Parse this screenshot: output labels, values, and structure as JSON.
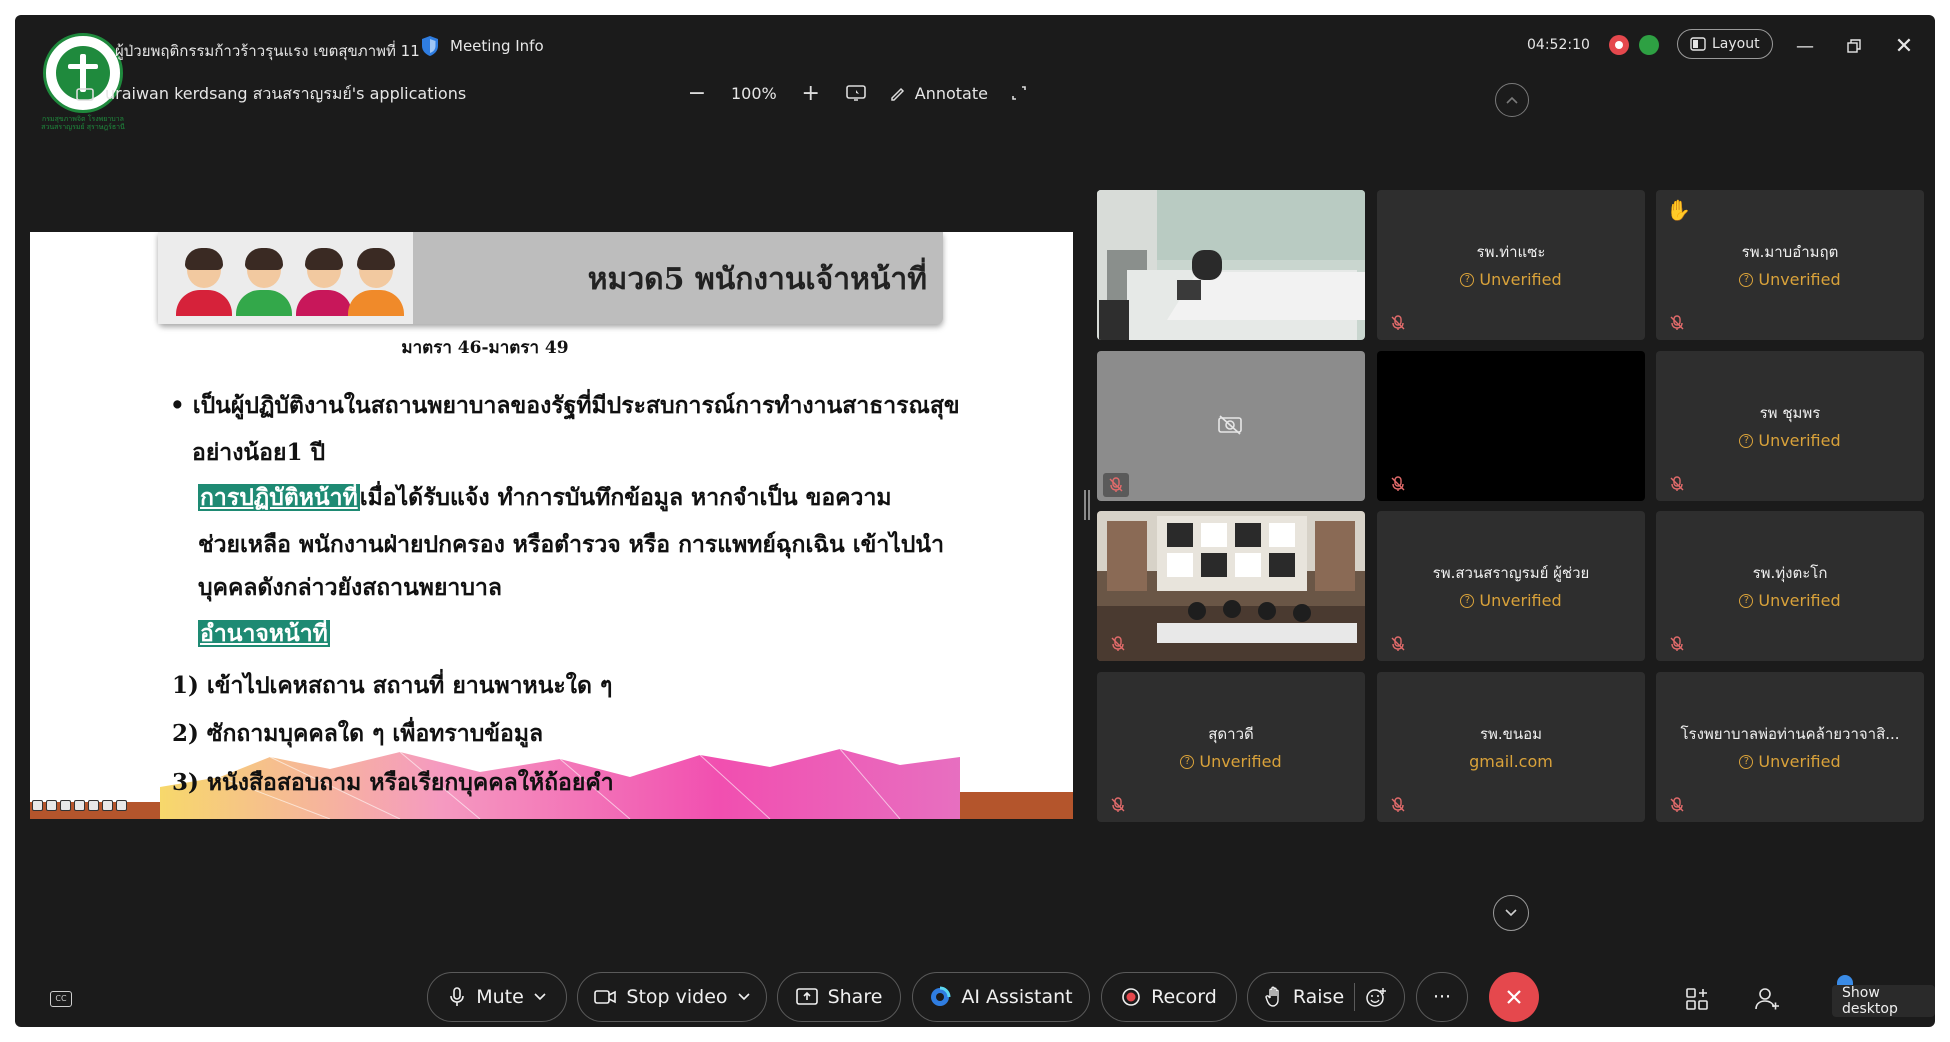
{
  "header": {
    "title": "ผู้ป่วยพฤติกรรมก้าวร้าวรุนแรง เขตสุขภาพที่ 11",
    "meeting_info": "Meeting Info",
    "app_title": "uraiwan kerdsang สวนสราญรมย์'s applications",
    "zoom_level": "100%",
    "annotate": "Annotate",
    "timer": "04:52:10",
    "layout": "Layout",
    "logo_text": "กรมสุขภาพจิต โรงพยาบาลสวนสราญรมย์ สุราษฎร์ธานี"
  },
  "slide": {
    "title": "หมวด5  พนักงานเจ้าหน้าที่",
    "subtitle": "มาตรา 46-มาตรา 49",
    "bullet1_line1": "•  เป็นผู้ปฏิบัติงานในสถานพยาบาลของรัฐที่มีประสบการณ์การทำงานสาธารณสุข",
    "bullet1_line2": "อย่างน้อย1 ปี",
    "duty_label": "การปฏิบัติหน้าที่",
    "duty_line1": "เมื่อได้รับแจ้ง ทำการบันทึกข้อมูล หากจำเป็น ขอความ",
    "duty_line2": "ช่วยเหลือ พนักงานฝ่ายปกครอง หรือตำรวจ หรือ การแพทย์ฉุกเฉิน เข้าไปนำ",
    "duty_line3": "บุคคลดังกล่าวยังสถานพยาบาล",
    "power_label": "อำนาจหน้าที่",
    "item1": "1) เข้าไปเคหสถาน สถานที่ ยานพาหนะใด ๆ",
    "item2": "2) ซักถามบุคคลใด ๆ เพื่อทราบข้อมูล",
    "item3": "3) หนังสือสอบถาม หรือเรียกบุคคลให้ถ้อยคำ"
  },
  "tiles": [
    {
      "name": "",
      "status": "",
      "type": "video-office"
    },
    {
      "name": "รพ.ท่าแซะ",
      "status": "Unverified"
    },
    {
      "name": "รพ.มาบอำมฤต",
      "status": "Unverified",
      "hand_raised": true
    },
    {
      "name": "",
      "status": "",
      "type": "camera-off"
    },
    {
      "name": "",
      "status": "",
      "type": "black"
    },
    {
      "name": "รพ ชุมพร",
      "status": "Unverified"
    },
    {
      "name": "",
      "status": "",
      "type": "video-room"
    },
    {
      "name": "รพ.สวนสราญรมย์ ผู้ช่วย",
      "status": "Unverified"
    },
    {
      "name": "รพ.ทุ่งตะโก",
      "status": "Unverified"
    },
    {
      "name": "สุดาวดี",
      "status": "Unverified"
    },
    {
      "name": "รพ.ขนอม",
      "status": "gmail.com"
    },
    {
      "name": "โรงพยาบาลพ่อท่านคล้ายวาจาสิ...",
      "status": "Unverified"
    }
  ],
  "toolbar": {
    "mute": "Mute",
    "stop_video": "Stop video",
    "share": "Share",
    "ai_assistant": "AI Assistant",
    "record": "Record",
    "raise": "Raise",
    "more": "···",
    "show_desktop": "Show desktop"
  },
  "colors": {
    "background": "#1b1b1b",
    "tile": "#2e2e2e",
    "unverified": "#d9a23a",
    "end_call": "#e5484d",
    "slide_highlight": "#1e8a73"
  }
}
